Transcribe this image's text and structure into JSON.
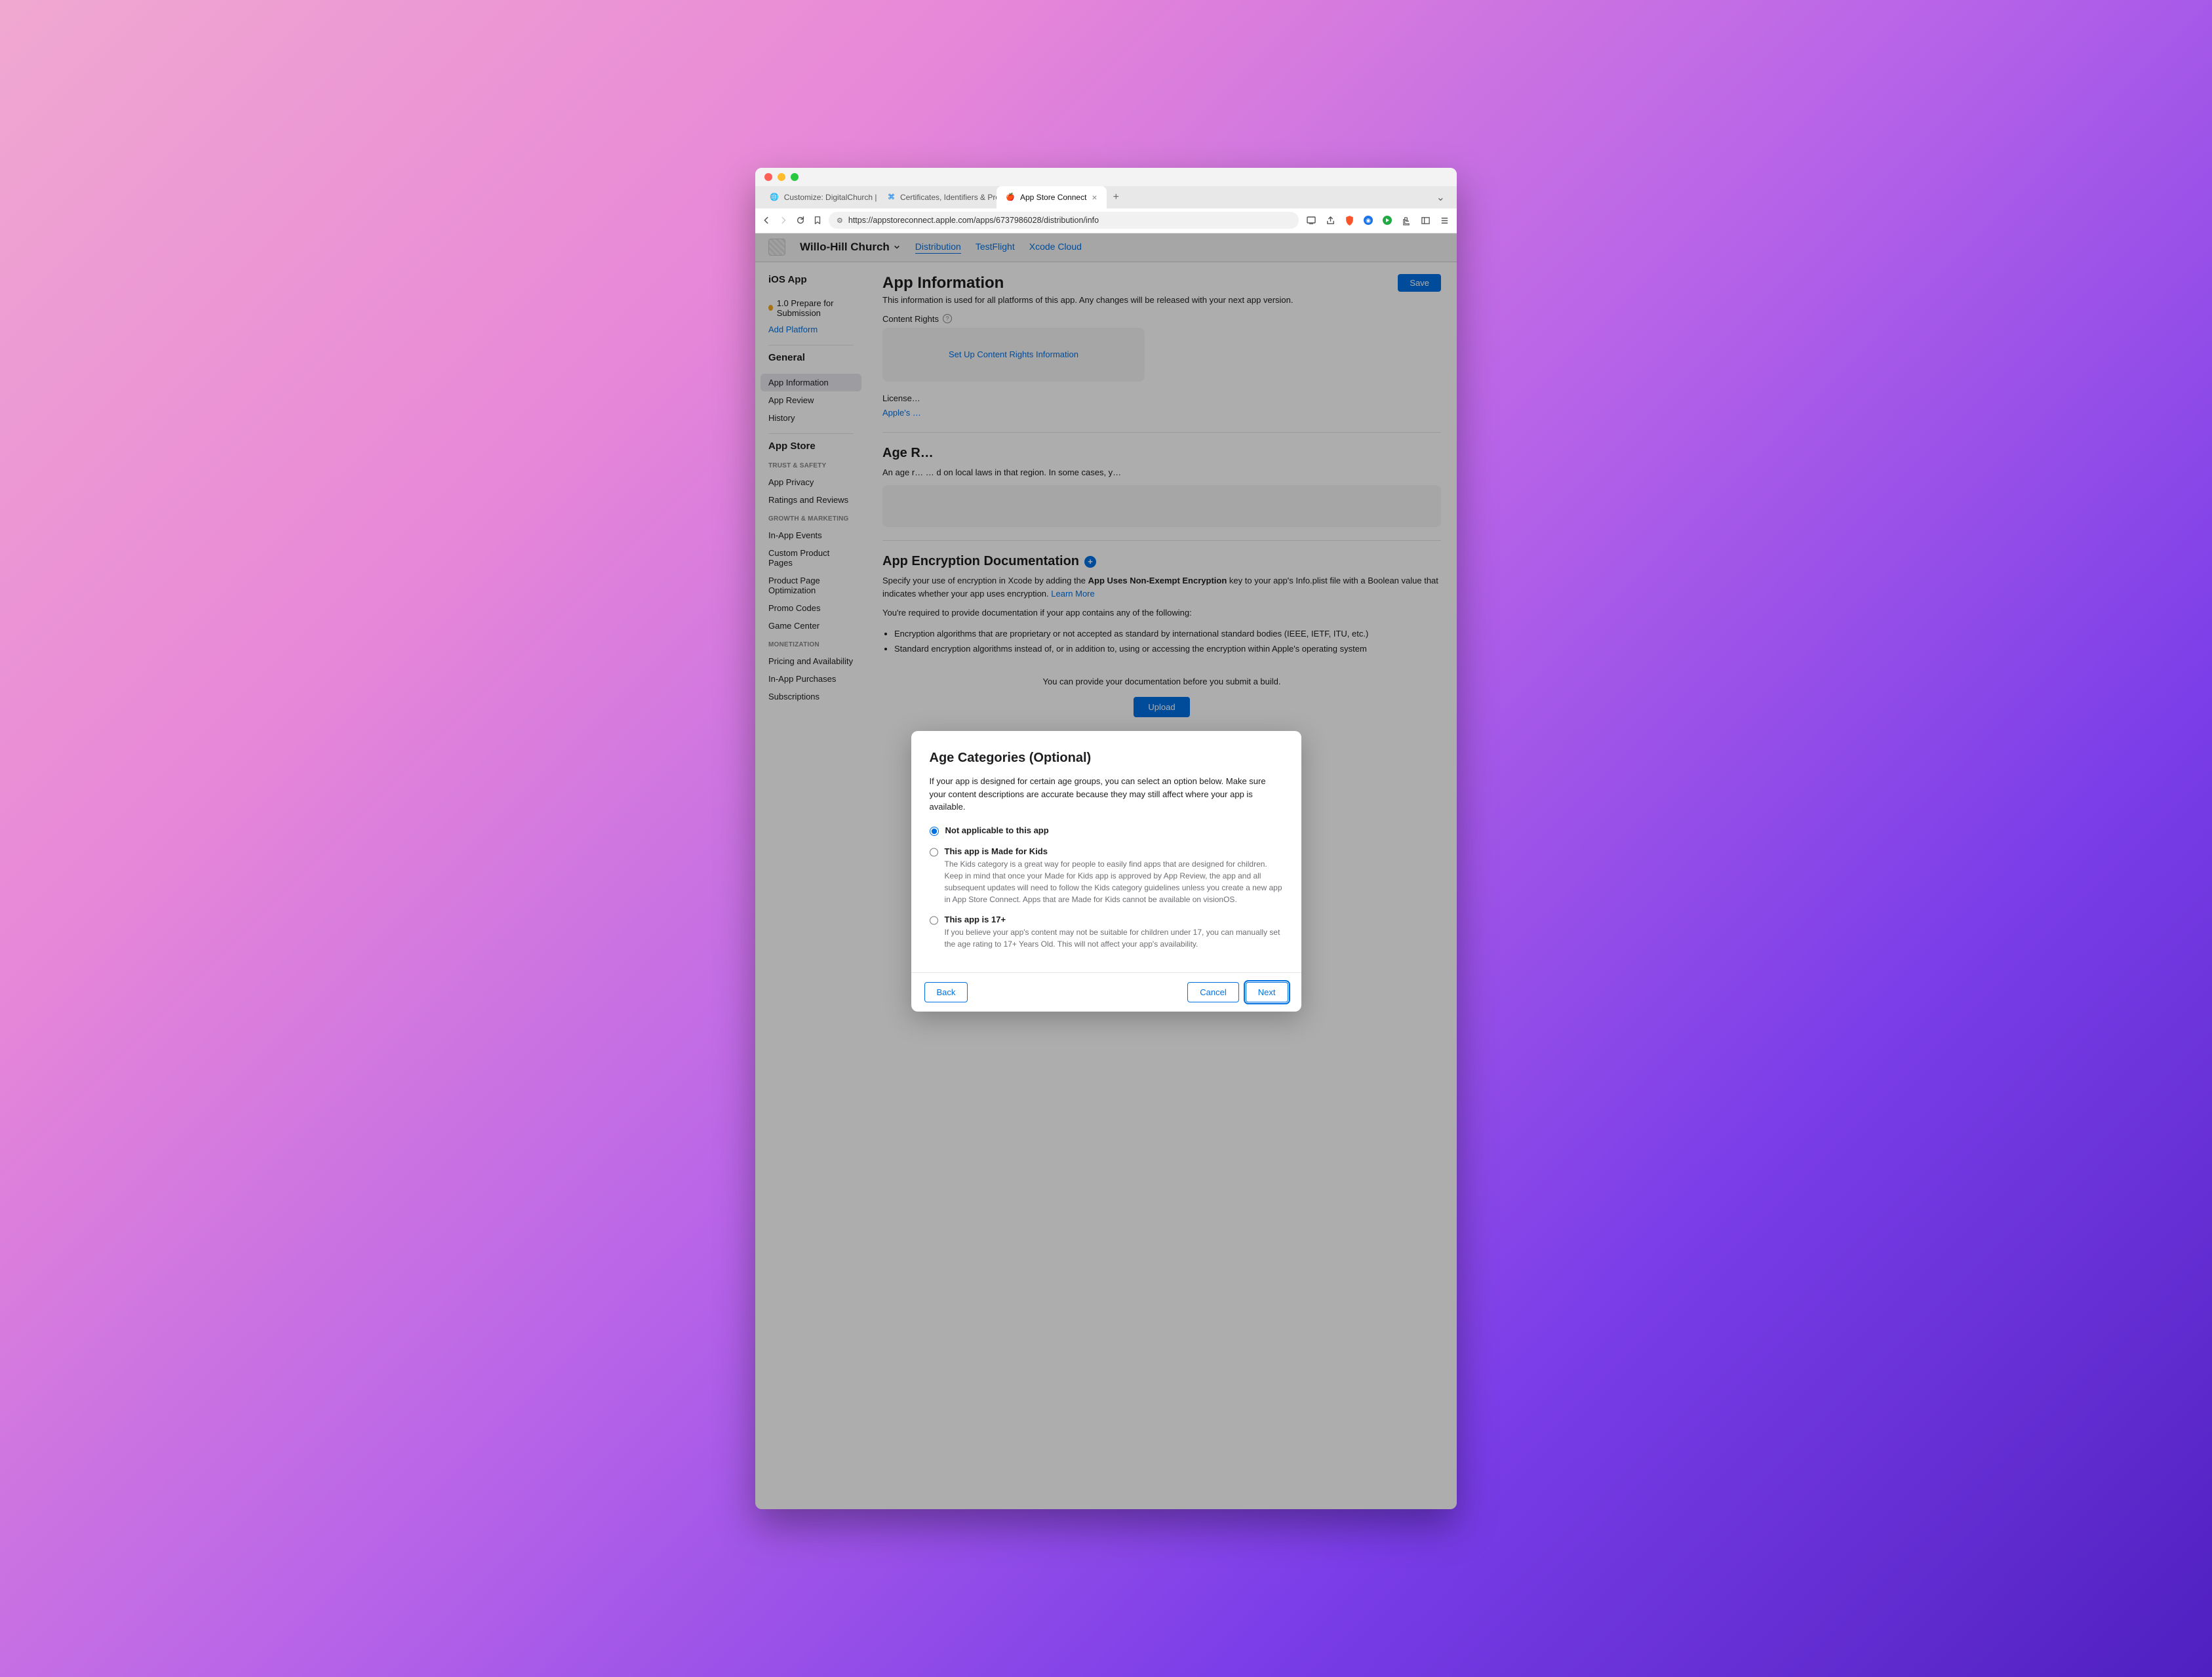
{
  "browser": {
    "tabs": [
      {
        "label": "Customize: DigitalChurch | Digital…"
      },
      {
        "label": "Certificates, Identifiers & Profiles"
      },
      {
        "label": "App Store Connect"
      }
    ],
    "url": "https://appstoreconnect.apple.com/apps/6737986028/distribution/info"
  },
  "header": {
    "app_name": "Willo-Hill Church",
    "nav": {
      "distribution": "Distribution",
      "testflight": "TestFlight",
      "xcode": "Xcode Cloud"
    }
  },
  "sidebar": {
    "ios_app": "iOS App",
    "status": "1.0 Prepare for Submission",
    "add_platform": "Add Platform",
    "general": "General",
    "general_items": {
      "app_info": "App Information",
      "app_review": "App Review",
      "history": "History"
    },
    "appstore": "App Store",
    "trust": "TRUST & SAFETY",
    "trust_items": {
      "privacy": "App Privacy",
      "ratings": "Ratings and Reviews"
    },
    "growth": "GROWTH & MARKETING",
    "growth_items": {
      "events": "In-App Events",
      "cpp": "Custom Product Pages",
      "ppo": "Product Page Optimization",
      "promo": "Promo Codes",
      "gc": "Game Center"
    },
    "monetization": "MONETIZATION",
    "mon_items": {
      "pricing": "Pricing and Availability",
      "iap": "In-App Purchases",
      "subs": "Subscriptions"
    }
  },
  "main": {
    "title": "App Information",
    "subtitle": "This information is used for all platforms of this app. Any changes will be released with your next app version.",
    "save": "Save",
    "content_rights": "Content Rights",
    "setup_cr": "Set Up Content Rights Information",
    "license": "License…",
    "apples": "Apple's …",
    "age_r": "Age R…",
    "age_body": "An age r… … d on local laws in that region. In some cases, y…",
    "enc_title": "App Encryption Documentation",
    "enc_body_a": "Specify your use of encryption in Xcode by adding the ",
    "enc_key": "App Uses Non-Exempt Encryption",
    "enc_body_b": " key to your app's Info.plist file with a Boolean value that indicates whether your app uses encryption. ",
    "learn_more": "Learn More",
    "enc_req": "You're required to provide documentation if your app contains any of the following:",
    "enc_li1": "Encryption algorithms that are proprietary or not accepted as standard by international standard bodies (IEEE, IETF, ITU, etc.)",
    "enc_li2": "Standard encryption algorithms instead of, or in addition to, using or accessing the encryption within Apple's operating system",
    "doc_note": "You can provide your documentation before you submit a build.",
    "upload": "Upload"
  },
  "modal": {
    "title": "Age Categories (Optional)",
    "desc": "If your app is designed for certain age groups, you can select an option below. Make sure your content descriptions are accurate because they may still affect where your app is available.",
    "opt1": "Not applicable to this app",
    "opt2": "This app is Made for Kids",
    "opt2_help": "The Kids category is a great way for people to easily find apps that are designed for children. Keep in mind that once your Made for Kids app is approved by App Review, the app and all subsequent updates will need to follow the Kids category guidelines unless you create a new app in App Store Connect. Apps that are Made for Kids cannot be available on visionOS.",
    "opt3": "This app is 17+",
    "opt3_help": "If you believe your app's content may not be suitable for children under 17, you can manually set the age rating to 17+ Years Old. This will not affect your app's availability.",
    "back": "Back",
    "cancel": "Cancel",
    "next": "Next"
  }
}
